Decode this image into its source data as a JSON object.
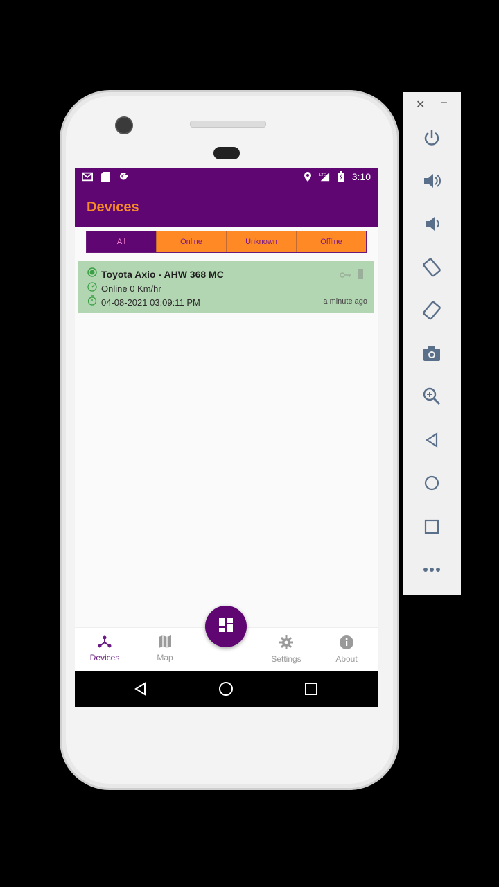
{
  "status_bar": {
    "time": "3:10"
  },
  "app_bar": {
    "title": "Devices"
  },
  "filter_tabs": [
    {
      "label": "All",
      "active": true
    },
    {
      "label": "Online",
      "active": false
    },
    {
      "label": "Unknown",
      "active": false
    },
    {
      "label": "Offline",
      "active": false
    }
  ],
  "devices": [
    {
      "name": "Toyota Axio - AHW 368 MC",
      "status": "Online 0 Km/hr",
      "timestamp": "04-08-2021 03:09:11 PM",
      "time_ago": "a minute ago",
      "status_color": "#3aa043"
    }
  ],
  "bottom_nav": [
    {
      "label": "Devices",
      "icon": "devices-icon",
      "active": true
    },
    {
      "label": "Map",
      "icon": "map-icon",
      "active": false
    },
    {
      "label": "Settings",
      "icon": "gear-icon",
      "active": false
    },
    {
      "label": "About",
      "icon": "info-icon",
      "active": false
    }
  ],
  "colors": {
    "primary": "#5f0672",
    "accent": "#f58a28",
    "card": "#b2d5b2"
  },
  "emulator_panel": {
    "buttons": [
      "power-icon",
      "volume-up-icon",
      "volume-down-icon",
      "rotate-left-icon",
      "rotate-right-icon",
      "camera-icon",
      "zoom-icon",
      "back-icon",
      "home-icon",
      "overview-icon",
      "more-icon"
    ]
  }
}
